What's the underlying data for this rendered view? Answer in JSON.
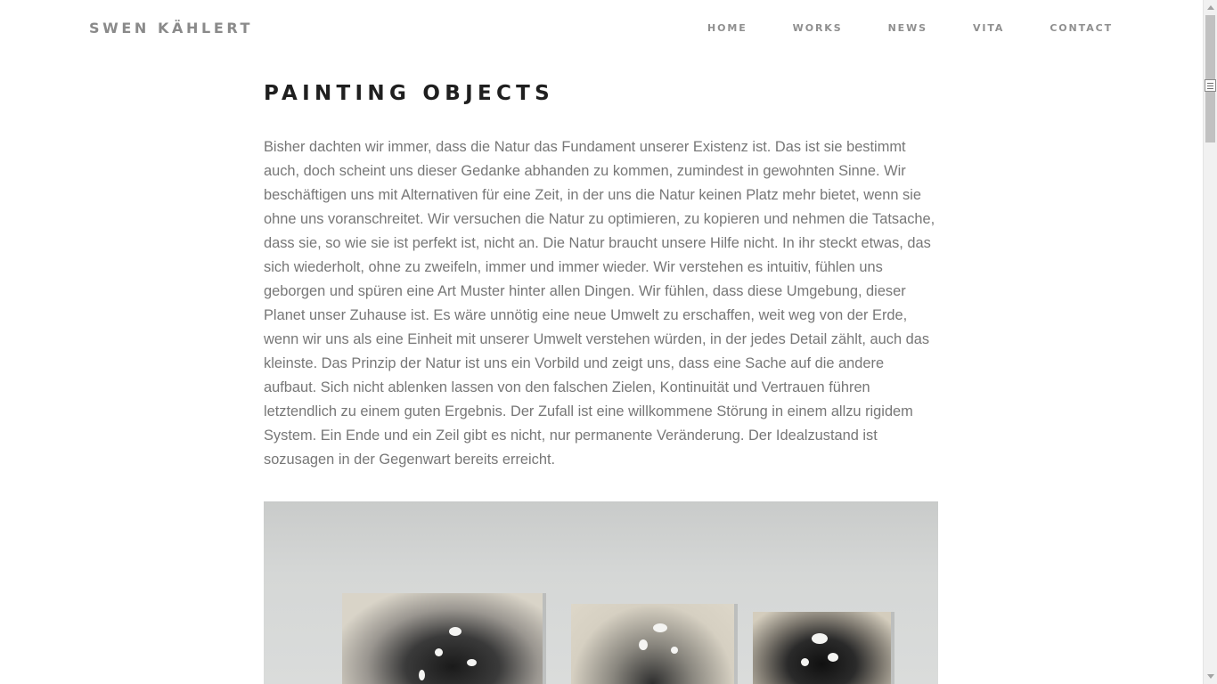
{
  "site": {
    "name": "SWEN KÄHLERT"
  },
  "nav": {
    "items": [
      {
        "label": "HOME"
      },
      {
        "label": "WORKS"
      },
      {
        "label": "NEWS"
      },
      {
        "label": "VITA"
      },
      {
        "label": "CONTACT"
      }
    ]
  },
  "main": {
    "title": "PAINTING OBJECTS",
    "body": "Bisher dachten wir immer, dass die Natur das Fundament unserer Existenz ist. Das ist sie bestimmt auch, doch scheint uns dieser Gedanke abhanden zu kommen, zumindest in gewohnten Sinne. Wir beschäftigen uns mit Alternativen für eine Zeit, in der uns die Natur keinen Platz mehr bietet, wenn sie ohne uns voranschreitet. Wir versuchen die Natur zu optimieren, zu kopieren und nehmen die Tatsache, dass sie, so wie sie ist perfekt ist, nicht an. Die Natur braucht unsere Hilfe nicht. In ihr steckt etwas, das sich wiederholt, ohne zu zweifeln, immer und immer wieder. Wir verstehen es intuitiv, fühlen uns geborgen und spüren eine Art Muster hinter allen Dingen. Wir fühlen, dass diese Umgebung, dieser Planet unser Zuhause ist. Es wäre unnötig eine neue Umwelt zu erschaffen, weit weg von der Erde, wenn wir uns als eine Einheit mit unserer Umwelt verstehen würden, in der jedes Detail zählt, auch das kleinste. Das Prinzip der Natur ist uns ein Vorbild und zeigt uns, dass eine Sache auf die andere aufbaut. Sich nicht ablenken lassen von den falschen Zielen, Kontinuität und Vertrauen führen letztendlich zu einem guten Ergebnis. Der Zufall ist eine willkommene Störung in einem allzu rigidem System. Ein Ende und ein Zeil gibt es nicht, nur permanente Veränderung. Der Idealzustand ist sozusagen in der Gegenwart bereits erreicht."
  },
  "colors": {
    "logo": "#8a8a8a",
    "nav": "#8f8f8f",
    "title": "#1f1f1f",
    "body_text": "#777777",
    "background": "#ffffff"
  },
  "icons": [
    "scroll-up-arrow-icon",
    "scroll-down-arrow-icon",
    "reader-mode-icon"
  ]
}
